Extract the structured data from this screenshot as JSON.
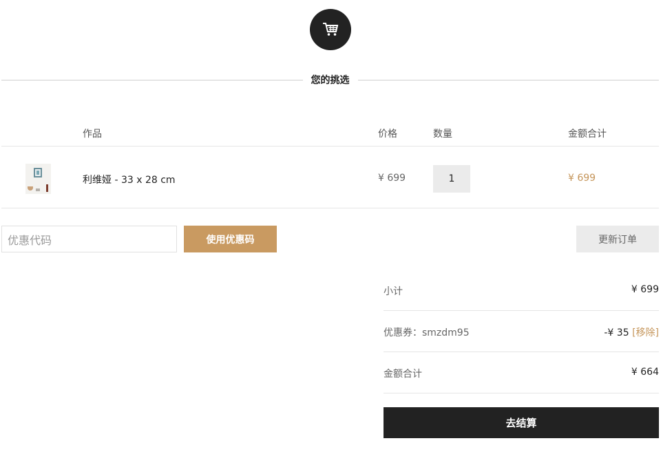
{
  "header": {
    "cart_icon": "shopping-cart-icon",
    "section_title": "您的挑选"
  },
  "table": {
    "columns": {
      "product": "作品",
      "price": "价格",
      "quantity": "数量",
      "line_total": "金额合计"
    },
    "rows": [
      {
        "name": "利维娅 - 33 x 28 cm",
        "price": "¥ 699",
        "quantity": "1",
        "line_total": "¥ 699"
      }
    ]
  },
  "coupon": {
    "placeholder": "优惠代码",
    "apply_label": "使用优惠码",
    "update_label": "更新订单"
  },
  "summary": {
    "subtotal_label": "小计",
    "subtotal_value": "¥ 699",
    "coupon_label": "优惠券：smzdm95",
    "coupon_value": "-¥ 35",
    "remove_label": "[移除]",
    "total_label": "金额合计",
    "total_value": "¥ 664"
  },
  "checkout": {
    "label": "去结算"
  },
  "colors": {
    "accent": "#c99a61",
    "dark": "#222222",
    "muted_button": "#ebebeb"
  }
}
